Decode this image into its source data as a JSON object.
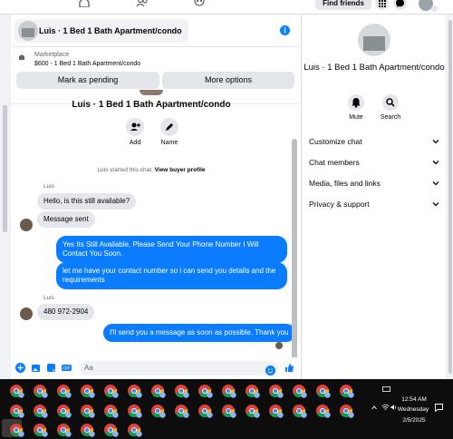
{
  "topnav": {
    "find_friends": "Find friends"
  },
  "chat": {
    "header_title": "Luis · 1 Bed 1 Bath Apartment/condo",
    "marketplace": {
      "label": "Marketplace",
      "item": "$600 - 1 Bed 1 Bath Apartment/condo",
      "mark_pending": "Mark as pending",
      "more_options": "More options"
    },
    "profile_name": "Luis · 1 Bed 1 Bath Apartment/condo",
    "actions": {
      "add": "Add",
      "name": "Name"
    },
    "started": {
      "text": "Luis started this chat.",
      "link": "View buyer profile"
    },
    "messages": {
      "sender1": "Luis",
      "m1": "Hello, is this still available?",
      "m2": "Message sent",
      "m3": "Yes Its Still Available, Please Send Your Phone Number I Will Contact You Soon.",
      "m4": "let me have your contact number so i can send you details and the requirements",
      "sender2": "Luis",
      "m5": "480 972-2904",
      "m6": "I'll send you a message as soon as possible. Thank you"
    },
    "composer_placeholder": "Aa"
  },
  "right_panel": {
    "name": "Luis · 1 Bed 1 Bath Apartment/condo",
    "mute": "Mute",
    "search": "Search",
    "rows": [
      "Customize chat",
      "Chat members",
      "Media, files and links",
      "Privacy & support"
    ]
  },
  "taskbar": {
    "time": "12:54 AM",
    "day": "Wednesday",
    "date": "2/5/2025"
  },
  "colors": {
    "accent": "#0a7cff",
    "bubble_in": "#e4e6eb",
    "taskbar": "#0d0d0d"
  }
}
